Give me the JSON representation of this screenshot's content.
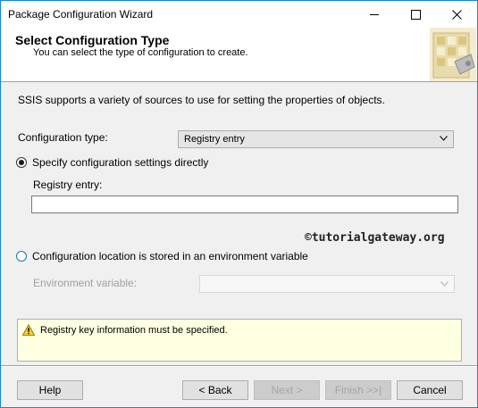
{
  "window": {
    "title": "Package Configuration Wizard"
  },
  "header": {
    "title": "Select Configuration Type",
    "subtitle": "You can select the type of configuration to create."
  },
  "description": "SSIS supports a variety of sources to use for setting the properties of objects.",
  "configuration_type": {
    "label": "Configuration type:",
    "selected": "Registry entry"
  },
  "option_direct": {
    "label": "Specify configuration settings directly",
    "checked": true,
    "registry_label": "Registry entry:",
    "registry_value": ""
  },
  "watermark": "©tutorialgateway.org",
  "option_env": {
    "label": "Configuration location is stored in an environment variable",
    "checked": false,
    "env_label": "Environment variable:",
    "env_value": ""
  },
  "message": {
    "icon": "warning-icon",
    "text": "Registry key information must be specified."
  },
  "buttons": {
    "help": "Help",
    "back": "< Back",
    "next": "Next >",
    "finish": "Finish >>|",
    "cancel": "Cancel"
  },
  "colors": {
    "window_border": "#1883d7",
    "message_background": "#ffffe1",
    "radio_accent": "#1e6fc8"
  }
}
